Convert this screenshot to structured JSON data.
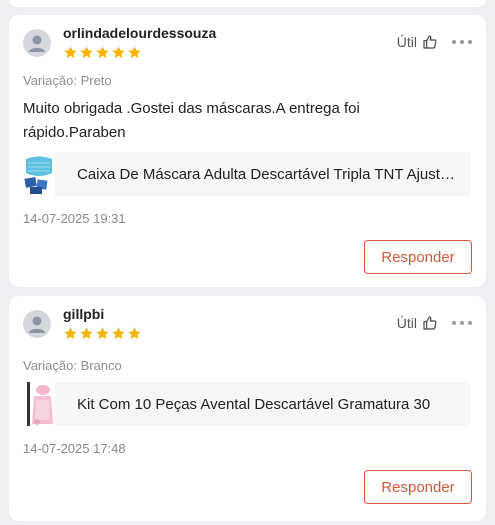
{
  "reviews": [
    {
      "username": "orlindadelourdessouza",
      "rating": 5,
      "helpful_label": "Útil",
      "variation": "Variação: Preto",
      "comment": "Muito obrigada .Gostei das máscaras.A entrega foi rápido.Paraben",
      "product_title": "Caixa De Máscara Adulta Descartável Tripla TNT Ajustável",
      "date": "14-07-2025 19:31",
      "reply_label": "Responder"
    },
    {
      "username": "gillpbi",
      "rating": 5,
      "helpful_label": "Útil",
      "variation": "Variação: Branco",
      "comment": "",
      "product_title": "Kit Com 10 Peças Avental Descartável Gramatura 30",
      "date": "14-07-2025 17:48",
      "reply_label": "Responder"
    }
  ],
  "colors": {
    "star": "#f5b301",
    "accent": "#d4593a",
    "background": "#efeff3"
  },
  "icons": {
    "avatar": "user-avatar-icon",
    "helpful": "thumbs-up-icon",
    "more": "more-options-icon",
    "star": "star-icon"
  }
}
